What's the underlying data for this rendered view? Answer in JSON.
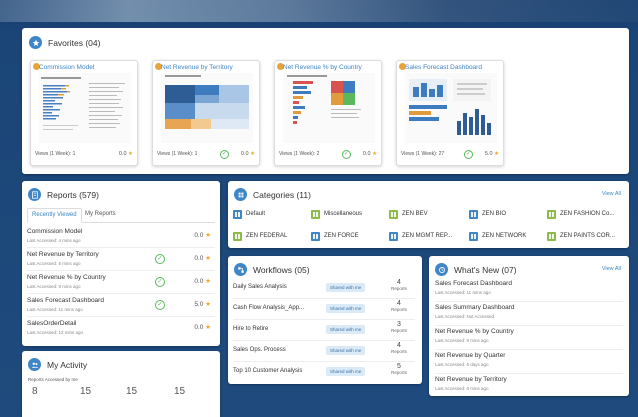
{
  "favorites": {
    "title": "Favorites (04)",
    "cards": [
      {
        "title": "Commission Model",
        "views": "Views (1 Week): 1",
        "rating": "0.0",
        "checked": false
      },
      {
        "title": "Net Revenue by Territory",
        "views": "Views (1 Week): 1",
        "rating": "0.0",
        "checked": true
      },
      {
        "title": "Net Revenue % by Country",
        "views": "Views (1 Week): 2",
        "rating": "0.0",
        "checked": true
      },
      {
        "title": "Sales Forecast Dashboard",
        "views": "Views (1 Week): 27",
        "rating": "5.0",
        "checked": true
      }
    ]
  },
  "reports": {
    "title": "Reports (579)",
    "tabs": [
      "Recently Viewed",
      "My Reports"
    ],
    "items": [
      {
        "name": "Commission Model",
        "sub": "Last Accessed: 4 mins ago",
        "rating": "0.0",
        "checked": false
      },
      {
        "name": "Net Revenue by Territory",
        "sub": "Last Accessed: 6 mins ago",
        "rating": "0.0",
        "checked": true
      },
      {
        "name": "Net Revenue % by Country",
        "sub": "Last Accessed: 9 mins ago",
        "rating": "0.0",
        "checked": true
      },
      {
        "name": "Sales Forecast Dashboard",
        "sub": "Last Accessed: 11 mins ago",
        "rating": "5.0",
        "checked": true
      },
      {
        "name": "SalesOrderDetail",
        "sub": "Last Accessed: 12 mins ago",
        "rating": "0.0",
        "checked": false
      }
    ]
  },
  "activity": {
    "title": "My Activity",
    "label": "Reports Accessed by me",
    "numbers": [
      "8",
      "15",
      "15",
      "15"
    ]
  },
  "categories": {
    "title": "Categories (11)",
    "view_all": "View All",
    "items": [
      {
        "label": "Default",
        "color": "blue"
      },
      {
        "label": "Miscellaneous",
        "color": "green"
      },
      {
        "label": "ZEN BEV",
        "color": "green"
      },
      {
        "label": "ZEN BIO",
        "color": "blue"
      },
      {
        "label": "ZEN FASHION Co...",
        "color": "green"
      },
      {
        "label": "ZEN FEDERAL",
        "color": "green"
      },
      {
        "label": "ZEN FORCE",
        "color": "blue"
      },
      {
        "label": "ZEN MGMT REP...",
        "color": "blue"
      },
      {
        "label": "ZEN NETWORK",
        "color": "blue"
      },
      {
        "label": "ZEN PAINTS COR...",
        "color": "green"
      }
    ]
  },
  "workflows": {
    "title": "Workflows (05)",
    "share_label": "Shared with me",
    "count_label": "Reports",
    "items": [
      {
        "name": "Daily Sales Analysis",
        "count": "4"
      },
      {
        "name": "Cash Flow Analysis_App...",
        "count": "4"
      },
      {
        "name": "Hire to Retire",
        "count": "3"
      },
      {
        "name": "Sales Ops. Process",
        "count": "4"
      },
      {
        "name": "Top 10 Customer Analysis",
        "count": "5"
      }
    ]
  },
  "whatsnew": {
    "title": "What's New (07)",
    "view_all": "View All",
    "items": [
      {
        "name": "Sales Forecast Dashboard",
        "sub": "Last Accessed: 11 mins ago"
      },
      {
        "name": "Sales Summary Dashboard",
        "sub": "Last Accessed: Not Accessed"
      },
      {
        "name": "Net Revenue % by Country",
        "sub": "Last Accessed: 9 mins ago"
      },
      {
        "name": "Net Revenue by Quarter",
        "sub": "Last Accessed: 6 days ago"
      },
      {
        "name": "Net Revenue by Territory",
        "sub": "Last Accessed: 6 mins ago"
      }
    ]
  },
  "colors": {
    "accent": "#3e86c6",
    "star": "#f0a52c",
    "check": "#5cb85c",
    "background": "#1e4a7d"
  },
  "icons": {
    "favorites": "star-icon",
    "reports": "report-icon",
    "activity": "people-icon",
    "categories": "grid-icon",
    "workflows": "workflow-icon",
    "whatsnew": "clock-icon"
  }
}
